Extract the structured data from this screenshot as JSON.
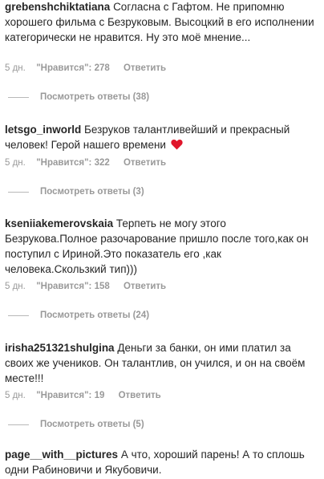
{
  "comments": [
    {
      "username": "grebenshchiktatiana",
      "text": "Согласна с Гафтом. Не припомню хорошего фильма с Безруковым. Высоцкий в его исполнении категорически не нравится. Ну это моё мнение...",
      "time": "5 дн.",
      "likes": "\"Нравится\": 278",
      "reply": "Ответить",
      "view_replies": "Посмотреть ответы (38)"
    },
    {
      "username": "letsgo_inworld",
      "text": "Безруков талантливейший и прекрасный человек! Герой нашего времени",
      "emoji": "heart-icon",
      "emoji_color": "#e0162b",
      "time": "5 дн.",
      "likes": "\"Нравится\": 322",
      "reply": "Ответить",
      "view_replies": "Посмотреть ответы (3)"
    },
    {
      "username": "kseniiakemerovskaia",
      "text": "Терпеть не могу этого Безрукова.Полное разочарование пришло после того,как он поступил с Ириной.Это показатель его ,как человека.Скользкий тип)))",
      "time": "5 дн.",
      "likes": "\"Нравится\": 158",
      "reply": "Ответить",
      "view_replies": "Посмотреть ответы (24)"
    },
    {
      "username": "irisha251321shulgina",
      "text": "Деньги за банки, он ими платил за своих же учеников. Он талантлив, он учился, и он на своём месте!!!",
      "time": "5 дн.",
      "likes": "\"Нравится\": 19",
      "reply": "Ответить",
      "view_replies": "Посмотреть ответы (5)"
    },
    {
      "username": "page__with__pictures",
      "text": "А что, хороший парень! А то сплошь одни Рабиновичи и Якубовичи."
    }
  ]
}
